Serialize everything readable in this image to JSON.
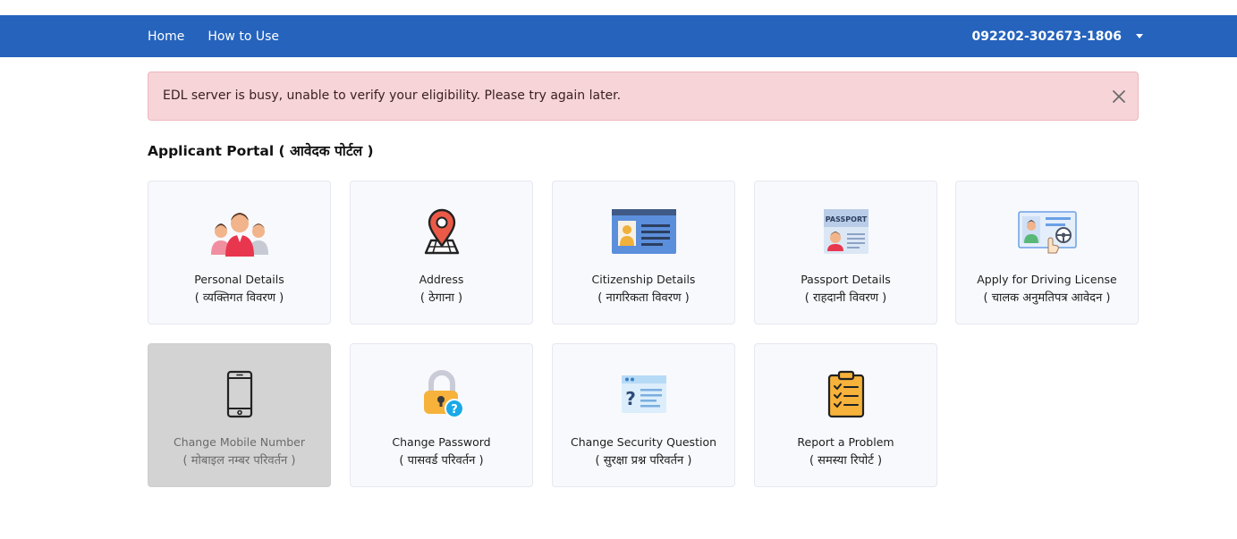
{
  "nav": {
    "home": "Home",
    "how_to_use": "How to Use",
    "user_id": "092202-302673-1806"
  },
  "alert": {
    "message": "EDL server is busy, unable to verify your eligibility. Please try again later."
  },
  "portal_title": "Applicant Portal ( आवेदक पोर्टल )",
  "cards": [
    {
      "title": "Personal Details",
      "subtitle": "( व्यक्तिगत विवरण )",
      "icon": "family-icon"
    },
    {
      "title": "Address",
      "subtitle": "( ठेगाना )",
      "icon": "map-pin-icon"
    },
    {
      "title": "Citizenship Details",
      "subtitle": "( नागरिकता विवरण )",
      "icon": "id-card-icon"
    },
    {
      "title": "Passport Details",
      "subtitle": "( राहदानी विवरण )",
      "icon": "passport-icon"
    },
    {
      "title": "Apply for Driving License",
      "subtitle": "( चालक अनुमतिपत्र आवेदन )",
      "icon": "driving-license-icon"
    },
    {
      "title": "Change Mobile Number",
      "subtitle": "( मोबाइल नम्बर परिवर्तन )",
      "icon": "mobile-phone-icon",
      "disabled": true
    },
    {
      "title": "Change Password",
      "subtitle": "( पासवर्ड परिवर्तन )",
      "icon": "padlock-question-icon"
    },
    {
      "title": "Change Security Question",
      "subtitle": "( सुरक्षा प्रश्न परिवर्तन )",
      "icon": "security-question-icon"
    },
    {
      "title": "Report a Problem",
      "subtitle": "( समस्या रिपोर्ट )",
      "icon": "clipboard-checklist-icon"
    }
  ],
  "colors": {
    "header": "#2563bd",
    "alert_bg": "#f6d4d7",
    "card_bg": "#f8f9fd",
    "card_disabled_bg": "#d3d3d3"
  }
}
